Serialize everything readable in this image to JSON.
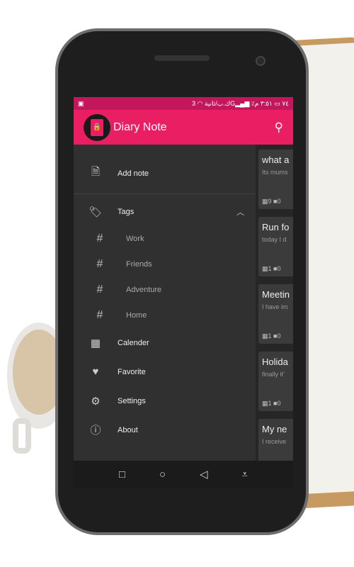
{
  "status_bar": {
    "left_icon": "image-icon",
    "carrier": "ك.ب/ثانية",
    "network": "3G",
    "battery": "٪٧٤",
    "time": "٣:٥١ م"
  },
  "app_bar": {
    "title": "Diary Note",
    "search_icon": "search-icon",
    "accent": "#e91e63"
  },
  "drawer": {
    "add_note": "Add note",
    "tags": "Tags",
    "tag_items": [
      "Work",
      "Friends",
      "Adventure",
      "Home"
    ],
    "calender": "Calender",
    "favorite": "Favorite",
    "settings": "Settings",
    "about": "About"
  },
  "notes": [
    {
      "title": "what a",
      "preview": "Its mums",
      "images": "9",
      "videos": "0"
    },
    {
      "title": "Run fo",
      "preview": "today I d",
      "images": "1",
      "videos": "0"
    },
    {
      "title": "Meetin",
      "preview": "I have im",
      "images": "1",
      "videos": "0"
    },
    {
      "title": "Holida",
      "preview": "finally it'",
      "images": "1",
      "videos": "0"
    },
    {
      "title": "My ne",
      "preview": "I receive"
    }
  ],
  "nav": {
    "recents": "□",
    "home": "○",
    "back": "◁",
    "menu": "⩡"
  }
}
